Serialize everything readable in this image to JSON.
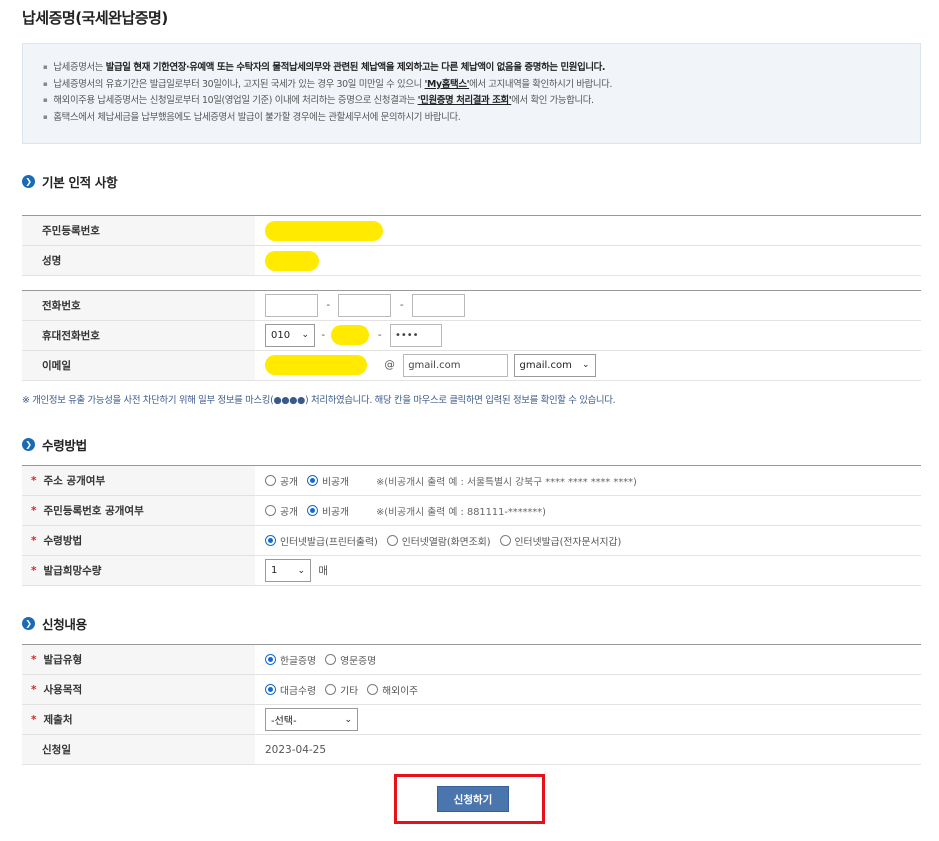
{
  "page_title": "납세증명(국세완납증명)",
  "notice": {
    "line1_a": "납세증명서는 ",
    "line1_b": "발급일 현재 기한연장·유예액 또는 수탁자의 물적납세의무와 관련된 체납액을 제외하고는 다른 체납액이 없음을 증명하는 민원입니다.",
    "line2_a": "납세증명서의 유효기간은 발급일로부터 30일이나, 고지된 국세가 있는 경우 30일 미만일 수 있으니 ",
    "line2_link": "'My홈택스'",
    "line2_b": "에서 고지내역을 확인하시기 바랍니다.",
    "line3_a": "해외이주용 납세증명서는 신청일로부터 10일(영업일 기준) 이내에 처리하는 증명으로 신청결과는 ",
    "line3_link": "'민원증명 처리결과 조회'",
    "line3_b": "에서 확인 가능합니다.",
    "line4": "홈택스에서 체납세금을 납부했음에도 납세증명서 발급이 불가할 경우에는 관할세무서에 문의하시기 바랍니다."
  },
  "section_basic": {
    "title": "기본 인적 사항",
    "rrn_label": "주민등록번호",
    "name_label": "성명",
    "phone_label": "전화번호",
    "mobile_label": "휴대전화번호",
    "mobile_prefix": "010",
    "mobile_last": "••••",
    "email_label": "이메일",
    "email_at": "@",
    "email_domain": "gmail.com",
    "email_domain_select": "gmail.com"
  },
  "privacy_note": "※ 개인정보 유출 가능성을 사전 차단하기 위해 일부 정보를 마스킹(●●●●) 처리하였습니다. 해당 칸을 마우스로 클릭하면 입력된 정보를 확인할 수 있습니다.",
  "section_receive": {
    "title": "수령방법",
    "address_label": "주소 공개여부",
    "rrn_open_label": "주민등록번호 공개여부",
    "method_label": "수령방법",
    "qty_label": "발급희망수량",
    "opt_public": "공개",
    "opt_private": "비공개",
    "address_hint": "※(비공개시 출력 예 : 서울특별시 강북구 **** **** **** ****)",
    "rrn_hint": "※(비공개시 출력 예 : 881111-*******)",
    "method_opt1": "인터넷발급(프린터출력)",
    "method_opt2": "인터넷열람(화면조회)",
    "method_opt3": "인터넷발급(전자문서지갑)",
    "qty_value": "1",
    "qty_unit": "매"
  },
  "section_apply": {
    "title": "신청내용",
    "type_label": "발급유형",
    "type_opt1": "한글증명",
    "type_opt2": "영문증명",
    "purpose_label": "사용목적",
    "purpose_opt1": "대금수령",
    "purpose_opt2": "기타",
    "purpose_opt3": "해외이주",
    "submit_to_label": "제출처",
    "submit_to_value": "-선택-",
    "date_label": "신청일",
    "date_value": "2023-04-25"
  },
  "submit_label": "신청하기",
  "colors": {
    "accent": "#1a6bb5",
    "button": "#4a76ad",
    "highlight_frame": "#e8101a",
    "mask": "#ffea00",
    "required": "#d9252a"
  }
}
